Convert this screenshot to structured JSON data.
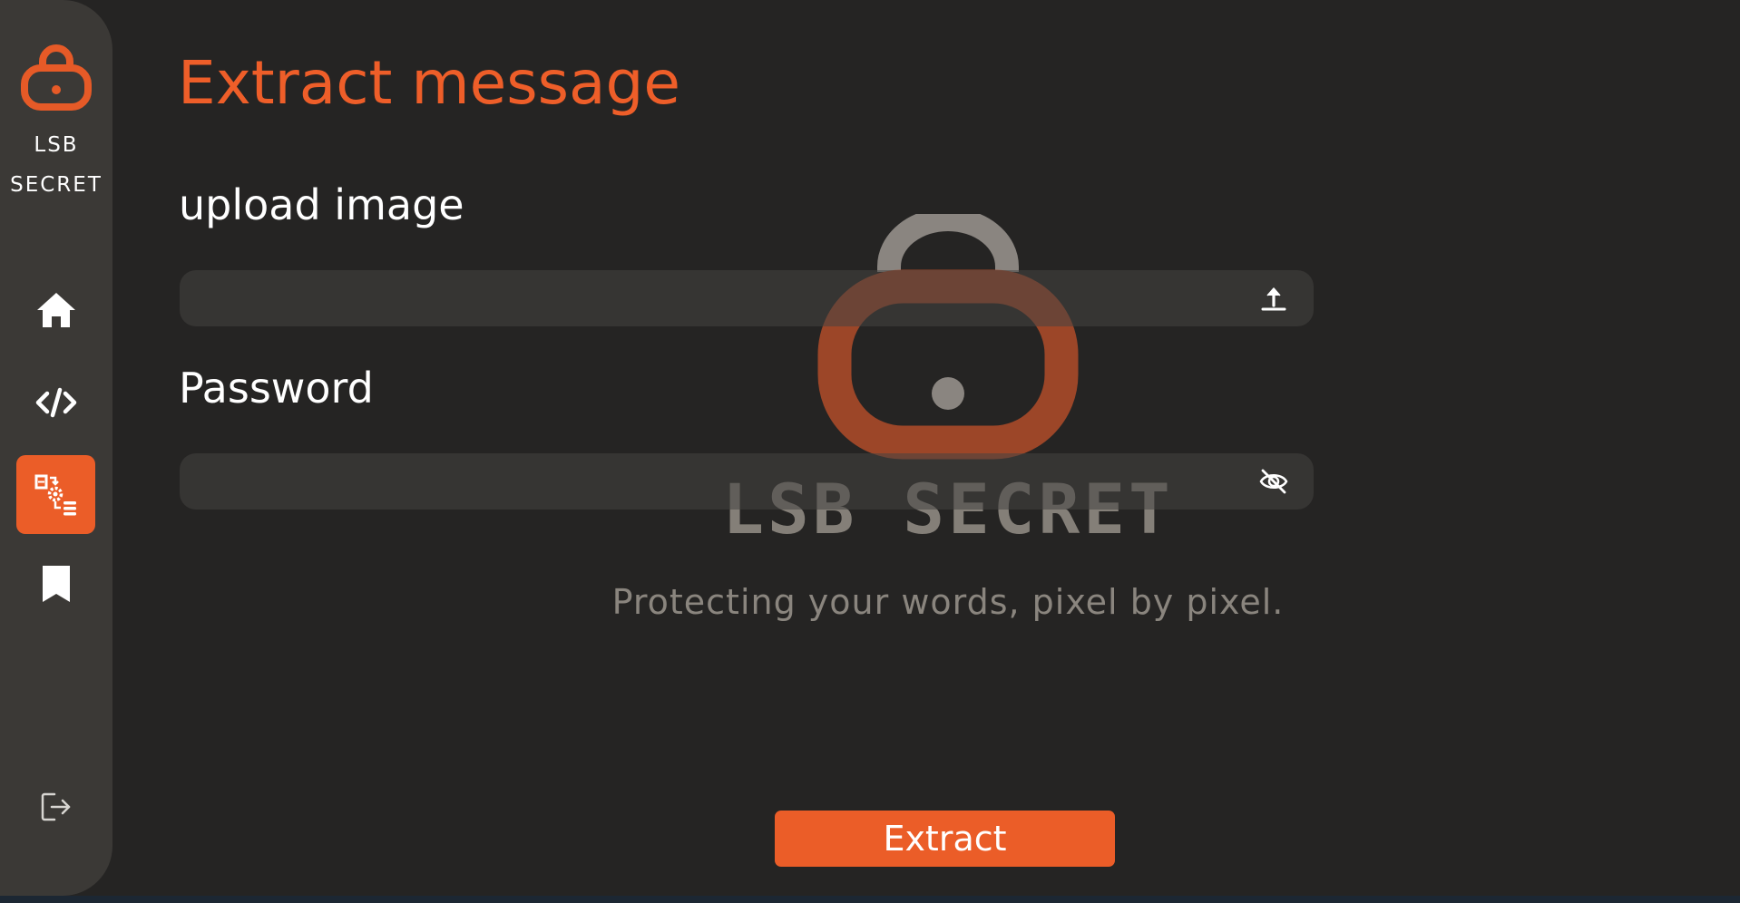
{
  "app": {
    "brand_line1": "LSB",
    "brand_line2": "SECRET"
  },
  "sidebar": {
    "items": [
      {
        "name": "home",
        "icon": "home-icon",
        "active": false
      },
      {
        "name": "code",
        "icon": "code-icon",
        "active": false
      },
      {
        "name": "extract",
        "icon": "extract-icon",
        "active": true
      },
      {
        "name": "bookmark",
        "icon": "bookmark-icon",
        "active": false
      }
    ],
    "logout_icon": "logout-icon"
  },
  "main": {
    "title": "Extract message",
    "upload": {
      "label": "upload image",
      "value": "",
      "icon": "upload-icon"
    },
    "password": {
      "label": "Password",
      "value": "",
      "icon": "eye-off-icon"
    },
    "extract_button": "Extract"
  },
  "watermark": {
    "title": "LSB SECRET",
    "tagline": "Protecting your words, pixel by pixel."
  },
  "colors": {
    "accent": "#eb5d28",
    "background": "#252423",
    "sidebar": "#3b3936"
  }
}
